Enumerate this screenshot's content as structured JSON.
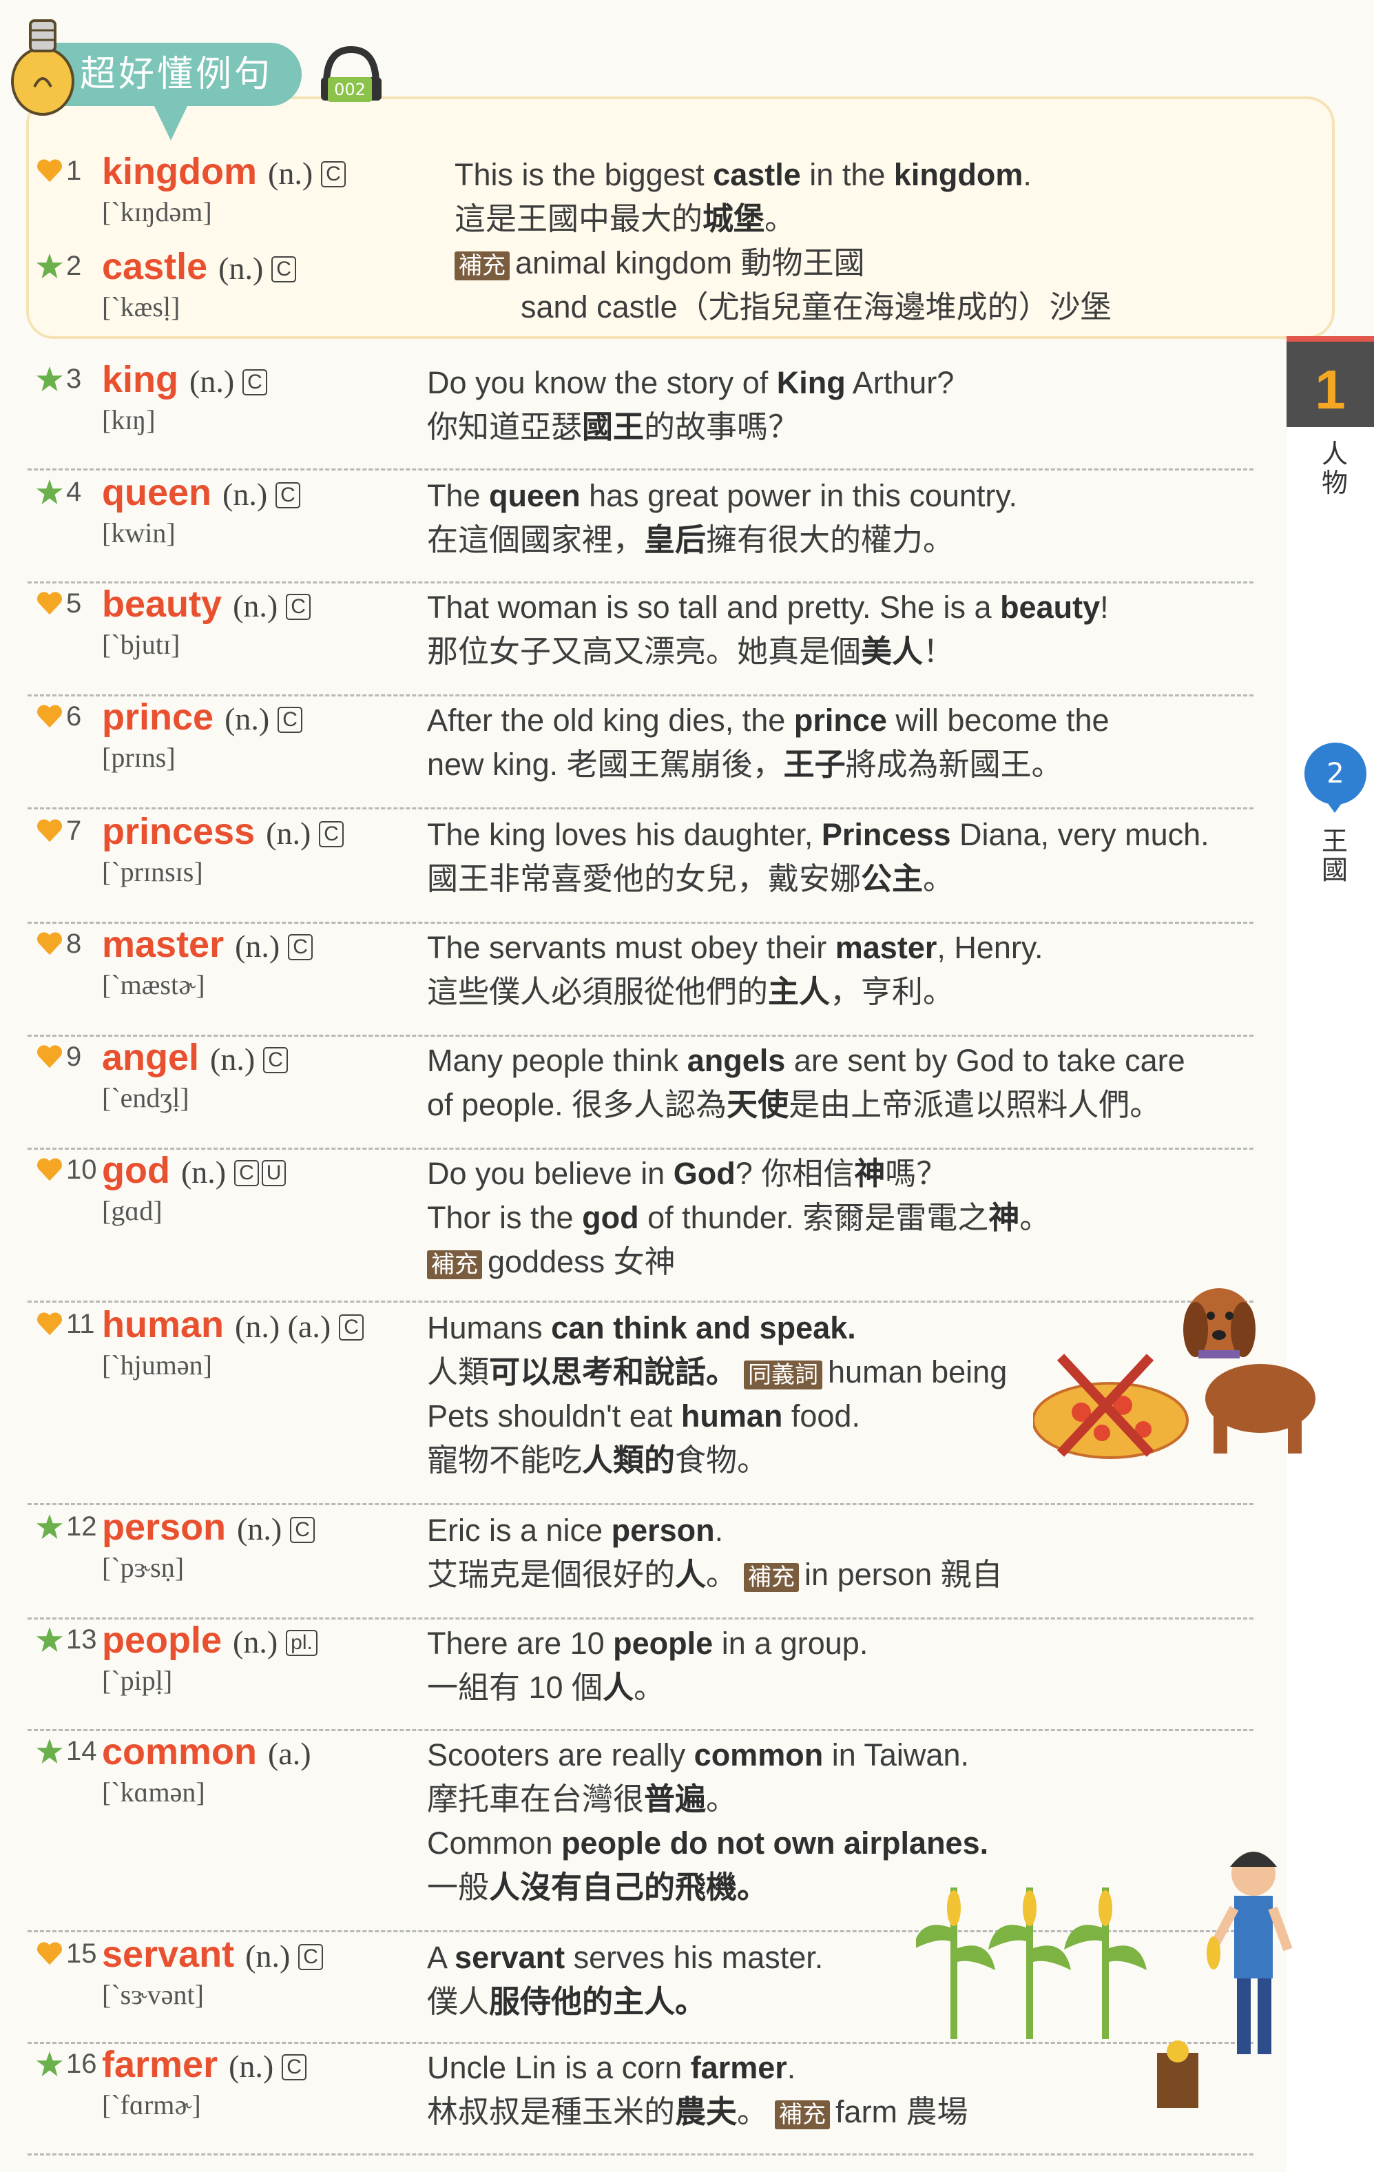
{
  "banner": {
    "title": "超好懂例句",
    "track": "002"
  },
  "side": {
    "chapter_num": "1",
    "chapter_label": "人物",
    "section_num": "2",
    "section_label": "王國"
  },
  "entries": [
    {
      "no": "1",
      "mark": "heart",
      "word": "kingdom",
      "pos": "(n.)",
      "boxes": [
        "C"
      ],
      "pron": "[ˋkɪŋdəm]",
      "lines": [
        [
          "This is the biggest ",
          "castle",
          " in the ",
          "kingdom",
          "."
        ],
        [
          "這是王國中最大的",
          "城堡",
          "。"
        ]
      ],
      "tags": [
        {
          "label": "補充",
          "text": "animal kingdom 動物王國"
        },
        {
          "label": "",
          "text": "sand castle（尤指兒童在海邊堆成的）沙堡"
        }
      ]
    },
    {
      "no": "2",
      "mark": "star",
      "word": "castle",
      "pos": "(n.)",
      "boxes": [
        "C"
      ],
      "pron": "[ˋkæsḷ]"
    },
    {
      "no": "3",
      "mark": "star",
      "word": "king",
      "pos": "(n.)",
      "boxes": [
        "C"
      ],
      "pron": "[kɪŋ]",
      "lines": [
        [
          "Do you know the story of ",
          "King",
          " Arthur?"
        ],
        [
          "你知道亞瑟",
          "國王",
          "的故事嗎？"
        ]
      ]
    },
    {
      "no": "4",
      "mark": "star",
      "word": "queen",
      "pos": "(n.)",
      "boxes": [
        "C"
      ],
      "pron": "[kwin]",
      "lines": [
        [
          "The ",
          "queen",
          " has great power in this country."
        ],
        [
          "在這個國家裡，",
          "皇后",
          "擁有很大的權力。"
        ]
      ]
    },
    {
      "no": "5",
      "mark": "heart",
      "word": "beauty",
      "pos": "(n.)",
      "boxes": [
        "C"
      ],
      "pron": "[ˋbjutɪ]",
      "lines": [
        [
          "That woman is so tall and pretty. She is a ",
          "beauty",
          "!"
        ],
        [
          "那位女子又高又漂亮。她真是個",
          "美人",
          "！"
        ]
      ]
    },
    {
      "no": "6",
      "mark": "heart",
      "word": "prince",
      "pos": "(n.)",
      "boxes": [
        "C"
      ],
      "pron": "[prɪns]",
      "lines": [
        [
          "After the old king dies, the ",
          "prince",
          " will become the"
        ],
        [
          "new king. 老國王駕崩後，",
          "王子",
          "將成為新國王。"
        ]
      ]
    },
    {
      "no": "7",
      "mark": "heart",
      "word": "princess",
      "pos": "(n.)",
      "boxes": [
        "C"
      ],
      "pron": "[ˋprɪnsɪs]",
      "lines": [
        [
          "The king loves his daughter, ",
          "Princess",
          " Diana, very much."
        ],
        [
          "國王非常喜愛他的女兒，戴安娜",
          "公主",
          "。"
        ]
      ]
    },
    {
      "no": "8",
      "mark": "heart",
      "word": "master",
      "pos": "(n.)",
      "boxes": [
        "C"
      ],
      "pron": "[ˋmæstɚ]",
      "lines": [
        [
          "The servants must obey their ",
          "master",
          ", Henry."
        ],
        [
          "這些僕人必須服從他們的",
          "主人",
          "，亨利。"
        ]
      ]
    },
    {
      "no": "9",
      "mark": "heart",
      "word": "angel",
      "pos": "(n.)",
      "boxes": [
        "C"
      ],
      "pron": "[ˋendʒḷ]",
      "lines": [
        [
          "Many people think ",
          "angels",
          " are sent by God to take care"
        ],
        [
          "of people. 很多人認為",
          "天使",
          "是由上帝派遣以照料人們。"
        ]
      ]
    },
    {
      "no": "10",
      "mark": "heart",
      "word": "god",
      "pos": "(n.)",
      "boxes": [
        "C",
        "U"
      ],
      "pron": "[gɑd]",
      "lines": [
        [
          "Do you believe in ",
          "God",
          "? 你相信",
          "神",
          "嗎？"
        ],
        [
          "Thor is the ",
          "god",
          " of thunder. 索爾是雷電之",
          "神",
          "。"
        ]
      ],
      "tags": [
        {
          "label": "補充",
          "text": "goddess 女神"
        }
      ]
    },
    {
      "no": "11",
      "mark": "heart",
      "word": "human",
      "pos": "(n.) (a.)",
      "boxes": [
        "C"
      ],
      "pron": "[ˋhjumən]",
      "lines": [
        [
          "Humans",
          " can think and speak."
        ],
        [
          "人類",
          "可以思考和說話。"
        ],
        [
          "Pets shouldn't eat ",
          "human",
          " food."
        ],
        [
          "寵物不能吃",
          "人類的",
          "食物。"
        ]
      ],
      "inline_tag": {
        "label": "同義詞",
        "text": "human being"
      }
    },
    {
      "no": "12",
      "mark": "star",
      "word": "person",
      "pos": "(n.)",
      "boxes": [
        "C"
      ],
      "pron": "[ˋpɝsṇ]",
      "lines": [
        [
          "Eric is a nice ",
          "person",
          "."
        ],
        [
          "艾瑞克是個很好的",
          "人",
          "。"
        ]
      ],
      "inline_tag": {
        "label": "補充",
        "text": "in person 親自"
      }
    },
    {
      "no": "13",
      "mark": "star",
      "word": "people",
      "pos": "(n.)",
      "boxes": [
        "pl."
      ],
      "pron": "[ˋpipḷ]",
      "lines": [
        [
          "There are 10 ",
          "people",
          " in a group."
        ],
        [
          "一組有 10 個",
          "人",
          "。"
        ]
      ]
    },
    {
      "no": "14",
      "mark": "star",
      "word": "common",
      "pos": "(a.)",
      "boxes": [],
      "pron": "[ˋkɑmən]",
      "lines": [
        [
          "Scooters are really ",
          "common",
          " in Taiwan."
        ],
        [
          "摩托車在台灣很",
          "普遍",
          "。"
        ],
        [
          "Common",
          " people do not own airplanes."
        ],
        [
          "一般",
          "人沒有自己的飛機。"
        ]
      ]
    },
    {
      "no": "15",
      "mark": "heart",
      "word": "servant",
      "pos": "(n.)",
      "boxes": [
        "C"
      ],
      "pron": "[ˋsɝvənt]",
      "lines": [
        [
          "A ",
          "servant",
          " serves his master."
        ],
        [
          "僕人",
          "服侍他的主人。"
        ]
      ]
    },
    {
      "no": "16",
      "mark": "star",
      "word": "farmer",
      "pos": "(n.)",
      "boxes": [
        "C"
      ],
      "pron": "[ˋfɑrmɚ]",
      "lines": [
        [
          "Uncle Lin is a corn ",
          "farmer",
          "."
        ],
        [
          "林叔叔是種玉米的",
          "農夫",
          "。"
        ]
      ],
      "inline_tag": {
        "label": "補充",
        "text": "farm 農場"
      }
    }
  ],
  "colors": {
    "headword": "#e8502f",
    "star": "#6ab04c",
    "heart": "#f5a623",
    "tag": "#7a5c3e",
    "banner": "#7cc5b8",
    "section_circle": "#2f7fd3"
  }
}
